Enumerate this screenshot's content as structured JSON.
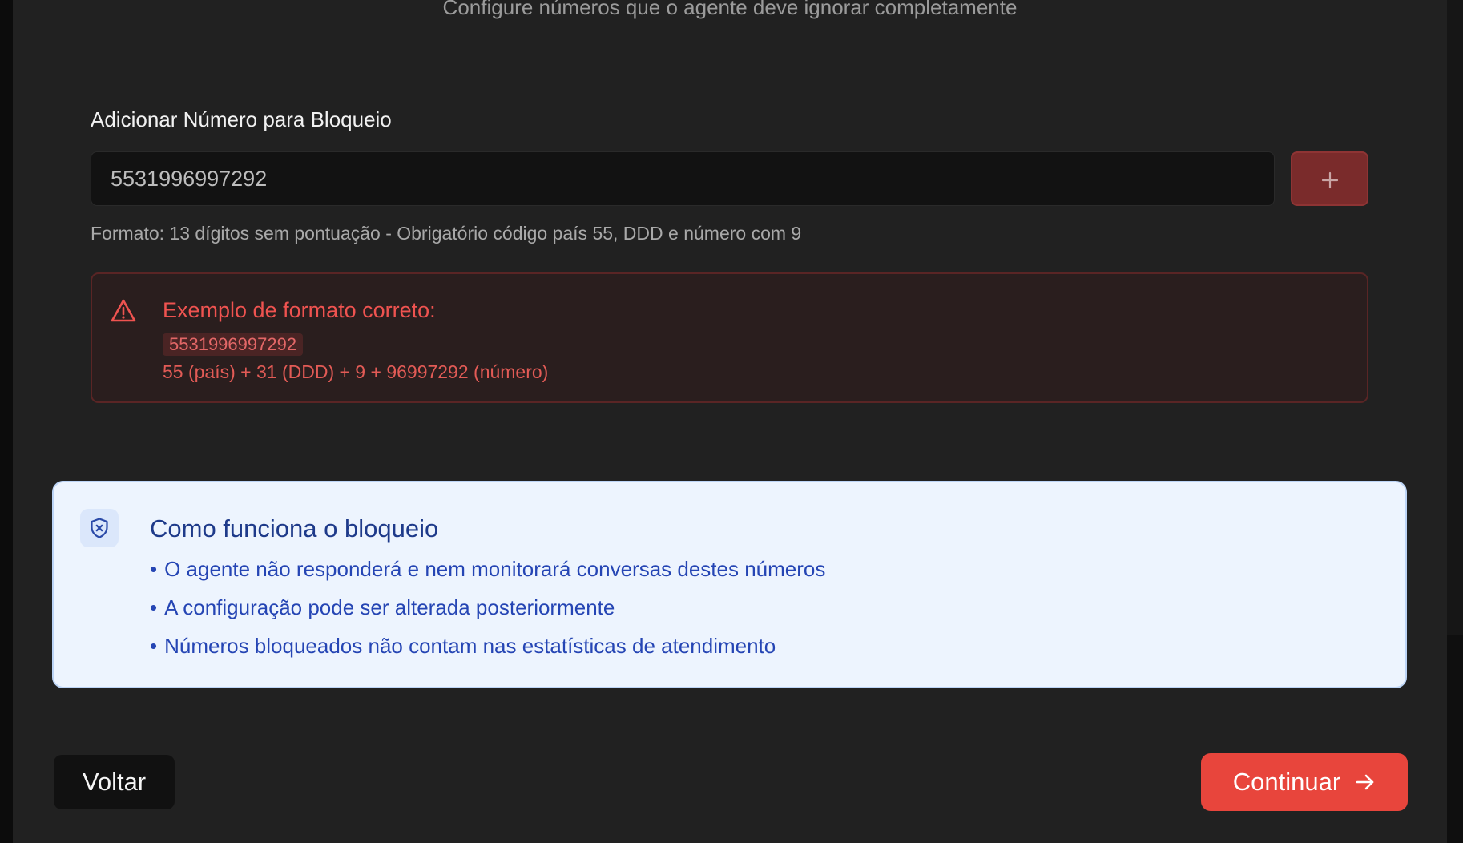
{
  "header": {
    "subtitle": "Configure números que o agente deve ignorar completamente"
  },
  "block_form": {
    "label": "Adicionar Número para Bloqueio",
    "input_value": "5531996997292",
    "add_button_icon": "plus-icon",
    "hint": "Formato: 13 dígitos sem pontuação - Obrigatório código país 55, DDD e número com 9"
  },
  "format_example": {
    "icon": "warning-triangle-icon",
    "title": "Exemplo de formato correto:",
    "code": "5531996997292",
    "explanation": "55 (país) + 31 (DDD) + 9 + 96997292 (número)"
  },
  "info": {
    "icon": "shield-x-icon",
    "title": "Como funciona o bloqueio",
    "items": [
      "O agente não responderá e nem monitorará conversas destes números",
      "A configuração pode ser alterada posteriormente",
      "Números bloqueados não contam nas estatísticas de atendimento"
    ]
  },
  "footer": {
    "back_label": "Voltar",
    "continue_label": "Continuar",
    "continue_icon": "arrow-right-icon"
  },
  "colors": {
    "background": "#212121",
    "accent": "#e8453c",
    "warning_text": "#ef5350",
    "info_background": "#edf4fe",
    "info_text": "#1e3a8a"
  }
}
